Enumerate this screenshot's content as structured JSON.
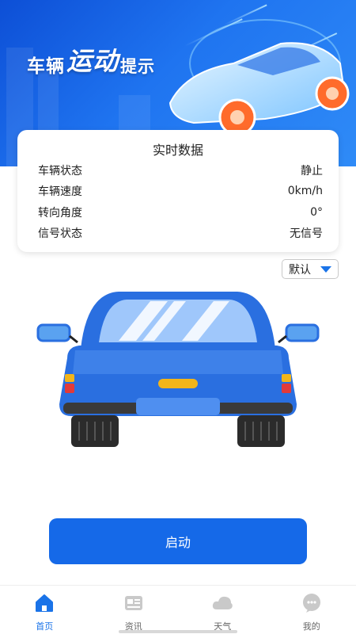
{
  "banner": {
    "title_part1": "车辆",
    "title_part2": "运动",
    "title_part3": "提示"
  },
  "realtime": {
    "title": "实时数据",
    "rows": [
      {
        "label": "车辆状态",
        "value": "静止"
      },
      {
        "label": "车辆速度",
        "value": "0km/h"
      },
      {
        "label": "转向角度",
        "value": "0°"
      },
      {
        "label": "信号状态",
        "value": "无信号"
      }
    ]
  },
  "mode_select": {
    "value": "默认"
  },
  "start_button": {
    "label": "启动"
  },
  "tabbar": {
    "items": [
      {
        "label": "首页",
        "icon": "home-icon",
        "active": true
      },
      {
        "label": "资讯",
        "icon": "news-icon",
        "active": false
      },
      {
        "label": "天气",
        "icon": "cloud-icon",
        "active": false
      },
      {
        "label": "我的",
        "icon": "chat-bubble-icon",
        "active": false
      }
    ]
  },
  "colors": {
    "accent": "#1a73e8",
    "button": "#1569e8",
    "car_body": "#2a6fe0",
    "inactive_icon": "#c9c9c9"
  }
}
